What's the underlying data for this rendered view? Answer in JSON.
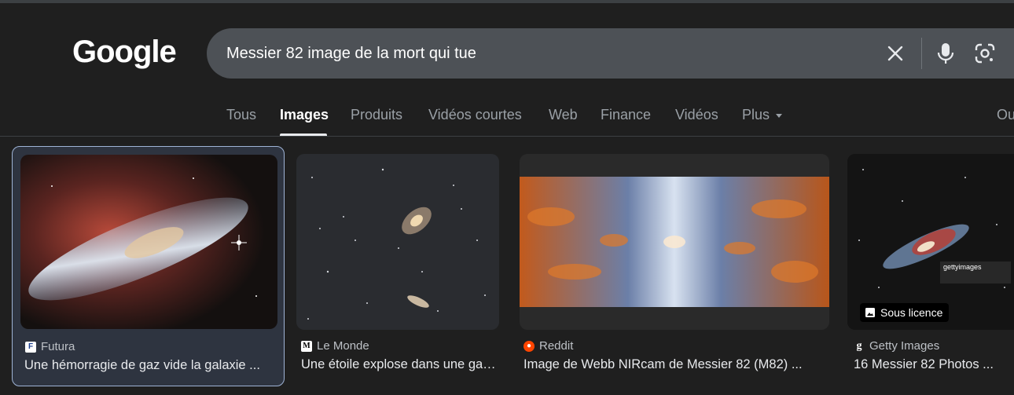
{
  "logo": {
    "text": "Google"
  },
  "search": {
    "query": "Messier 82 image de la mort qui tue",
    "icons": [
      "close-icon",
      "mic-icon",
      "lens-icon"
    ]
  },
  "tabs": [
    {
      "label": "Tous"
    },
    {
      "label": "Images",
      "active": true
    },
    {
      "label": "Produits"
    },
    {
      "label": "Vidéos courtes"
    },
    {
      "label": "Web"
    },
    {
      "label": "Finance"
    },
    {
      "label": "Vidéos"
    },
    {
      "label": "Plus"
    }
  ],
  "right_clipped": "Ou",
  "results": [
    {
      "source": "Futura",
      "favicon": "F",
      "title": "Une hémorragie de gaz vide la galaxie ..."
    },
    {
      "source": "Le Monde",
      "favicon": "M",
      "title": "Une étoile explose dans une galaxie ..."
    },
    {
      "source": "Reddit",
      "favicon": "reddit-icon",
      "title": "Image de Webb NIRcam de Messier 82 (M82) ..."
    },
    {
      "source": "Getty Images",
      "favicon": "g",
      "title": "16 Messier 82 Photos ...",
      "badge": "Sous licence",
      "watermark": "gettyimages"
    }
  ],
  "colors": {
    "background": "#1f1f1f",
    "searchbar": "#4d5156",
    "selected_card": "#2e3440",
    "selected_border": "#9fb4d6",
    "reddit": "#ff4500"
  }
}
